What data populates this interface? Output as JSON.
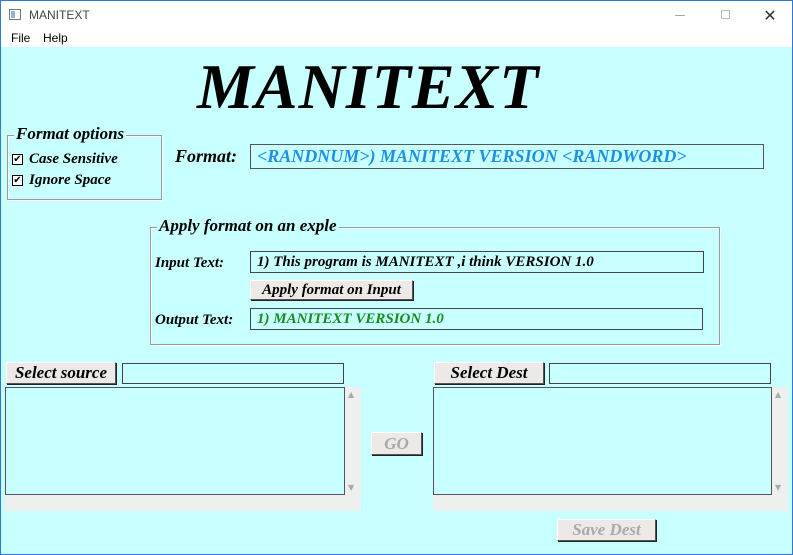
{
  "window": {
    "title": "MANITEXT"
  },
  "menu": {
    "items": [
      "File",
      "Help"
    ]
  },
  "app_title": "MANITEXT",
  "format_options": {
    "title": "Format options",
    "case_sensitive": {
      "label": "Case Sensitive",
      "checked": true,
      "mark": "✔"
    },
    "ignore_space": {
      "label": "Ignore Space",
      "checked": true,
      "mark": "✔"
    }
  },
  "format": {
    "label": "Format:",
    "value": "<RANDNUM>) MANITEXT VERSION <RANDWORD>",
    "color": "#1e90e0"
  },
  "example": {
    "title": "Apply format on  an exple",
    "input_label": "Input Text:",
    "input_value": "1) This program is MANITEXT ,i think VERSION 1.0",
    "apply_button": "Apply format on Input",
    "output_label": "Output Text:",
    "output_value": "1) MANITEXT VERSION 1.0",
    "output_color": "#168a1e"
  },
  "source": {
    "button": "Select source",
    "path": ""
  },
  "dest": {
    "button": "Select Dest",
    "path": ""
  },
  "go_button": "GO",
  "save_button": "Save Dest",
  "colors": {
    "background": "#c8ffff",
    "disabled_text": "#a9a9a9"
  }
}
